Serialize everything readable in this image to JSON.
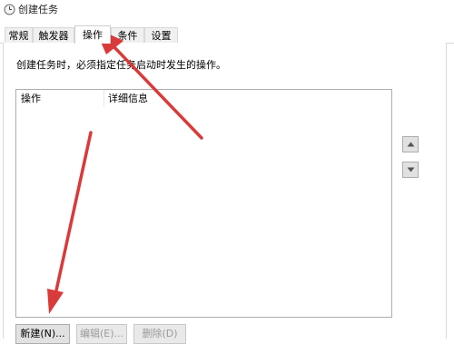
{
  "window": {
    "title": "创建任务",
    "icon": "clock-icon"
  },
  "tabs": [
    {
      "label": "常规",
      "active": false
    },
    {
      "label": "触发器",
      "active": false
    },
    {
      "label": "操作",
      "active": true
    },
    {
      "label": "条件",
      "active": false
    },
    {
      "label": "设置",
      "active": false
    }
  ],
  "actions_page": {
    "description": "创建任务时，必须指定任务启动时发生的操作。",
    "columns": [
      "操作",
      "详细信息"
    ],
    "rows": []
  },
  "side_buttons": {
    "up_icon": "triangle-up-icon",
    "down_icon": "triangle-down-icon"
  },
  "buttons": {
    "new": {
      "label": "新建(N)...",
      "enabled": true
    },
    "edit": {
      "label": "编辑(E)...",
      "enabled": false
    },
    "delete": {
      "label": "删除(D)",
      "enabled": false
    }
  },
  "annotation": {
    "color": "#d93a3a",
    "icon": "red-arrow-annotation"
  }
}
